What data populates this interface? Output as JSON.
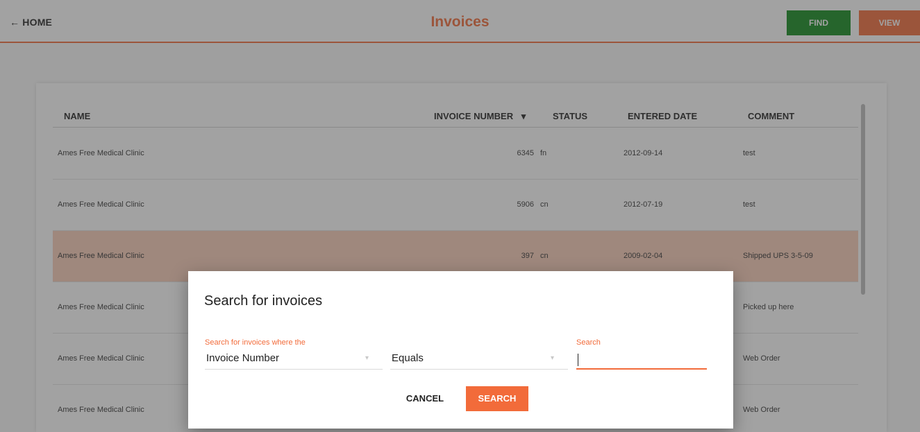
{
  "header": {
    "home_label": "← HOME",
    "title": "Invoices",
    "find_label": "FIND",
    "view_label": "VIEW"
  },
  "colors": {
    "accent": "#f26b3a",
    "find_button": "#138a1e",
    "highlight_row": "#f9cdb9"
  },
  "table": {
    "columns": [
      "NAME",
      "INVOICE NUMBER",
      "STATUS",
      "ENTERED DATE",
      "COMMENT"
    ],
    "sort_indicator": "▾",
    "rows": [
      {
        "name": "Ames Free Medical Clinic",
        "invoice_number": "6345",
        "status": "fn",
        "entered_date": "2012-09-14",
        "comment": "test"
      },
      {
        "name": "Ames Free Medical Clinic",
        "invoice_number": "5906",
        "status": "cn",
        "entered_date": "2012-07-19",
        "comment": "test"
      },
      {
        "name": "Ames Free Medical Clinic",
        "invoice_number": "397",
        "status": "cn",
        "entered_date": "2009-02-04",
        "comment": "Shipped UPS 3-5-09"
      },
      {
        "name": "Ames Free Medical Clinic",
        "invoice_number": "",
        "status": "",
        "entered_date": "",
        "comment": "Picked up here"
      },
      {
        "name": "Ames Free Medical Clinic",
        "invoice_number": "",
        "status": "",
        "entered_date": "",
        "comment": "Web Order"
      },
      {
        "name": "Ames Free Medical Clinic",
        "invoice_number": "",
        "status": "",
        "entered_date": "",
        "comment": "Web Order"
      }
    ]
  },
  "dialog": {
    "title": "Search for invoices",
    "field_label": "Search for invoices where the",
    "field_value": "Invoice Number",
    "operator_value": "Equals",
    "search_label": "Search",
    "search_value": "",
    "cancel_label": "CANCEL",
    "search_button_label": "SEARCH",
    "dropdown_icon": "▾"
  }
}
